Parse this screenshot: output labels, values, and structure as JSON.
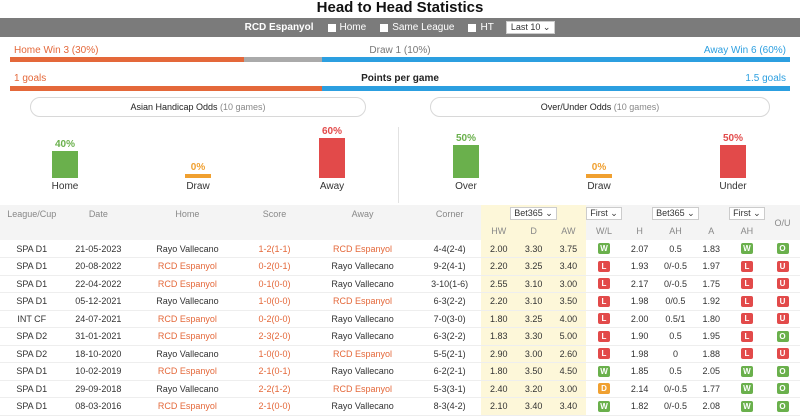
{
  "title": "Head to Head Statistics",
  "filter": {
    "team": "RCD Espanyol",
    "options": [
      "Home",
      "Same League",
      "HT"
    ],
    "last_select": "Last 10 ⌄"
  },
  "summary": {
    "home_win": "Home Win 3 (30%)",
    "draw": "Draw 1 (10%)",
    "away_win": "Away Win 6 (60%)",
    "home_share": 0.3,
    "draw_share": 0.1,
    "away_share": 0.6
  },
  "ppg": {
    "left": "1 goals",
    "title": "Points per game",
    "right": "1.5 goals",
    "left_share": 0.4
  },
  "asian_box": {
    "title": "Asian Handicap Odds",
    "sub": "(10 games)"
  },
  "ou_box": {
    "title": "Over/Under Odds",
    "sub": "(10 games)"
  },
  "asian_stats": [
    {
      "pct": "40%",
      "label": "Home",
      "value": 40,
      "color": "#6ab04c"
    },
    {
      "pct": "0%",
      "label": "Draw",
      "value": 0,
      "color": "#f0a030"
    },
    {
      "pct": "60%",
      "label": "Away",
      "value": 60,
      "color": "#e24a4a"
    }
  ],
  "ou_stats": [
    {
      "pct": "50%",
      "label": "Over",
      "value": 50,
      "color": "#6ab04c"
    },
    {
      "pct": "0%",
      "label": "Draw",
      "value": 0,
      "color": "#f0a030"
    },
    {
      "pct": "50%",
      "label": "Under",
      "value": 50,
      "color": "#e24a4a"
    }
  ],
  "table": {
    "headers": [
      "League/Cup",
      "Date",
      "Home",
      "Score",
      "Away",
      "Corner"
    ],
    "bookmaker1": "Bet365 ⌄",
    "period1": "First ⌄",
    "odds_headers": [
      "HW",
      "D",
      "AW",
      "W/L"
    ],
    "bookmaker2": "Bet365 ⌄",
    "period2": "First ⌄",
    "ah_headers": [
      "H",
      "AH",
      "A",
      "AH"
    ],
    "ou_header": "O/U",
    "rows": [
      {
        "league": "SPA D1",
        "date": "21-05-2023",
        "home": "Rayo Vallecano",
        "score": "1-2(1-1)",
        "away": "RCD Espanyol",
        "corner": "4-4(2-4)",
        "hw": "2.00",
        "d": "3.30",
        "aw": "3.75",
        "wl": "W",
        "h": "2.07",
        "ah": "0.5",
        "a": "1.83",
        "ahr": "W",
        "ou": "O"
      },
      {
        "league": "SPA D1",
        "date": "20-08-2022",
        "home": "RCD Espanyol",
        "score": "0-2(0-1)",
        "away": "Rayo Vallecano",
        "corner": "9-2(4-1)",
        "hw": "2.20",
        "d": "3.25",
        "aw": "3.40",
        "wl": "L",
        "h": "1.93",
        "ah": "0/-0.5",
        "a": "1.97",
        "ahr": "L",
        "ou": "U"
      },
      {
        "league": "SPA D1",
        "date": "22-04-2022",
        "home": "RCD Espanyol",
        "score": "0-1(0-0)",
        "away": "Rayo Vallecano",
        "corner": "3-10(1-6)",
        "hw": "2.55",
        "d": "3.10",
        "aw": "3.00",
        "wl": "L",
        "h": "2.17",
        "ah": "0/-0.5",
        "a": "1.75",
        "ahr": "L",
        "ou": "U"
      },
      {
        "league": "SPA D1",
        "date": "05-12-2021",
        "home": "Rayo Vallecano",
        "score": "1-0(0-0)",
        "away": "RCD Espanyol",
        "corner": "6-3(2-2)",
        "hw": "2.20",
        "d": "3.10",
        "aw": "3.50",
        "wl": "L",
        "h": "1.98",
        "ah": "0/0.5",
        "a": "1.92",
        "ahr": "L",
        "ou": "U"
      },
      {
        "league": "INT CF",
        "date": "24-07-2021",
        "home": "RCD Espanyol",
        "score": "0-2(0-0)",
        "away": "Rayo Vallecano",
        "corner": "7-0(3-0)",
        "hw": "1.80",
        "d": "3.25",
        "aw": "4.00",
        "wl": "L",
        "h": "2.00",
        "ah": "0.5/1",
        "a": "1.80",
        "ahr": "L",
        "ou": "U"
      },
      {
        "league": "SPA D2",
        "date": "31-01-2021",
        "home": "RCD Espanyol",
        "score": "2-3(2-0)",
        "away": "Rayo Vallecano",
        "corner": "6-3(2-2)",
        "hw": "1.83",
        "d": "3.30",
        "aw": "5.00",
        "wl": "L",
        "h": "1.90",
        "ah": "0.5",
        "a": "1.95",
        "ahr": "L",
        "ou": "O"
      },
      {
        "league": "SPA D2",
        "date": "18-10-2020",
        "home": "Rayo Vallecano",
        "score": "1-0(0-0)",
        "away": "RCD Espanyol",
        "corner": "5-5(2-1)",
        "hw": "2.90",
        "d": "3.00",
        "aw": "2.60",
        "wl": "L",
        "h": "1.98",
        "ah": "0",
        "a": "1.88",
        "ahr": "L",
        "ou": "U"
      },
      {
        "league": "SPA D1",
        "date": "10-02-2019",
        "home": "RCD Espanyol",
        "score": "2-1(0-1)",
        "away": "Rayo Vallecano",
        "corner": "6-2(2-1)",
        "hw": "1.80",
        "d": "3.50",
        "aw": "4.50",
        "wl": "W",
        "h": "1.85",
        "ah": "0.5",
        "a": "2.05",
        "ahr": "W",
        "ou": "O"
      },
      {
        "league": "SPA D1",
        "date": "29-09-2018",
        "home": "Rayo Vallecano",
        "score": "2-2(1-2)",
        "away": "RCD Espanyol",
        "corner": "5-3(3-1)",
        "hw": "2.40",
        "d": "3.20",
        "aw": "3.00",
        "wl": "D",
        "h": "2.14",
        "ah": "0/-0.5",
        "a": "1.77",
        "ahr": "W",
        "ou": "O"
      },
      {
        "league": "SPA D1",
        "date": "08-03-2016",
        "home": "RCD Espanyol",
        "score": "2-1(0-0)",
        "away": "Rayo Vallecano",
        "corner": "8-3(4-2)",
        "hw": "2.10",
        "d": "3.40",
        "aw": "3.40",
        "wl": "W",
        "h": "1.82",
        "ah": "0/-0.5",
        "a": "2.08",
        "ahr": "W",
        "ou": "O"
      }
    ]
  }
}
